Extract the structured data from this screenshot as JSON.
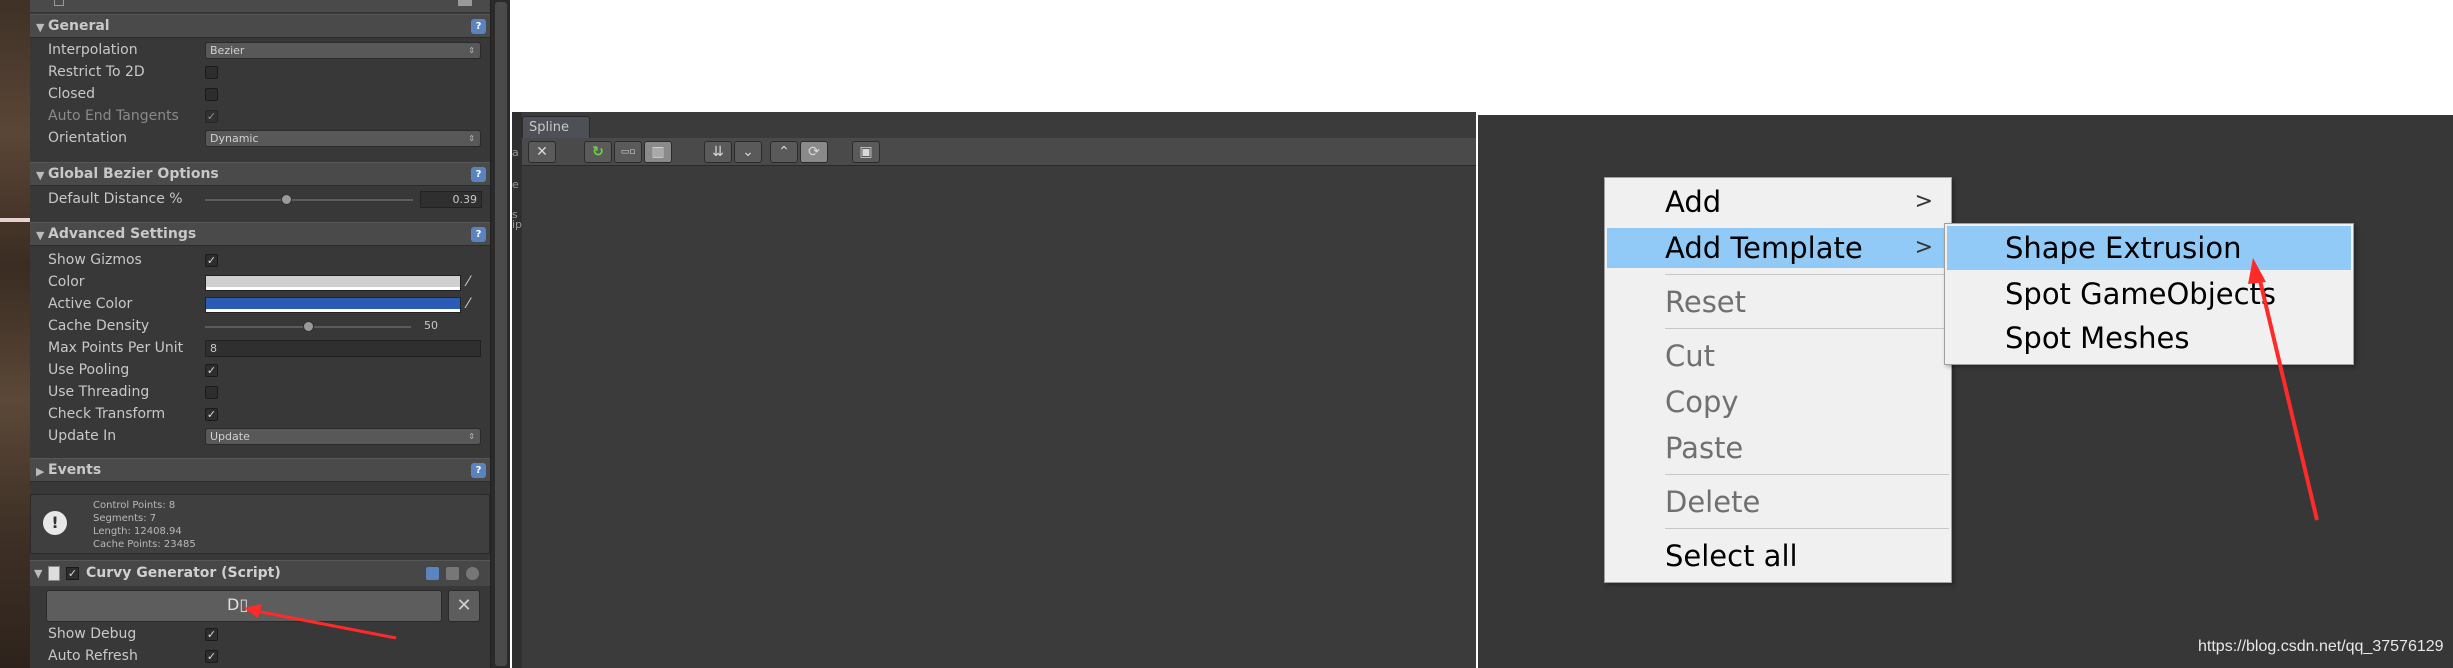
{
  "inspector": {
    "top_component": "",
    "sections": {
      "general": "General",
      "global_bezier": "Global Bezier Options",
      "advanced": "Advanced Settings",
      "events": "Events"
    },
    "general": {
      "interpolation_label": "Interpolation",
      "interpolation_value": "Bezier",
      "restrict_2d_label": "Restrict To 2D",
      "restrict_2d_checked": false,
      "closed_label": "Closed",
      "closed_checked": false,
      "auto_end_tangents_label": "Auto End Tangents",
      "auto_end_tangents_checked": true,
      "orientation_label": "Orientation",
      "orientation_value": "Dynamic"
    },
    "global_bezier": {
      "default_distance_label": "Default Distance %",
      "default_distance_value": "0.39",
      "default_distance_fraction": 0.39
    },
    "advanced": {
      "show_gizmos_label": "Show Gizmos",
      "show_gizmos_checked": true,
      "color_label": "Color",
      "color_value": "#cfcfcf",
      "active_color_label": "Active Color",
      "active_color_value": "#2c5bb5",
      "cache_density_label": "Cache Density",
      "cache_density_value": "50",
      "cache_density_fraction": 0.5,
      "max_points_label": "Max Points Per Unit",
      "max_points_value": "8",
      "use_pooling_label": "Use Pooling",
      "use_pooling_checked": true,
      "use_threading_label": "Use Threading",
      "use_threading_checked": false,
      "check_transform_label": "Check Transform",
      "check_transform_checked": true,
      "update_in_label": "Update In",
      "update_in_value": "Update"
    },
    "info": {
      "control_points": "Control Points: 8",
      "segments": "Segments: 7",
      "length": "Length: 12408.94",
      "cache_points": "Cache Points: 23485"
    },
    "curvy_generator": {
      "title": "Curvy Generator (Script)",
      "enabled": true,
      "show_debug_label": "Show Debug",
      "show_debug_checked": true,
      "auto_refresh_label": "Auto Refresh",
      "auto_refresh_checked": true
    }
  },
  "spline_window": {
    "tab_label": "Spline",
    "edge_labels": [
      "a",
      "e",
      "s",
      "ip"
    ]
  },
  "context_menu": {
    "items": [
      {
        "label": "Add",
        "submenu": true,
        "enabled": true
      },
      {
        "label": "Add Template",
        "submenu": true,
        "enabled": true,
        "highlighted": true
      },
      {
        "label": "Reset",
        "enabled": false
      },
      {
        "label": "Cut",
        "enabled": false
      },
      {
        "label": "Copy",
        "enabled": false
      },
      {
        "label": "Paste",
        "enabled": false
      },
      {
        "label": "Delete",
        "enabled": false
      },
      {
        "label": "Select all",
        "enabled": true
      }
    ],
    "submenu_glyph": ">",
    "submenu_items": [
      {
        "label": "Shape Extrusion",
        "highlighted": true
      },
      {
        "label": "Spot GameObjects"
      },
      {
        "label": "Spot Meshes"
      }
    ]
  },
  "watermark": "https://blog.csdn.net/qq_37576129",
  "colors": {
    "highlight": "#91c9f7",
    "annotation_arrow": "#ff2a2a",
    "help_icon": "#5a84c0"
  }
}
